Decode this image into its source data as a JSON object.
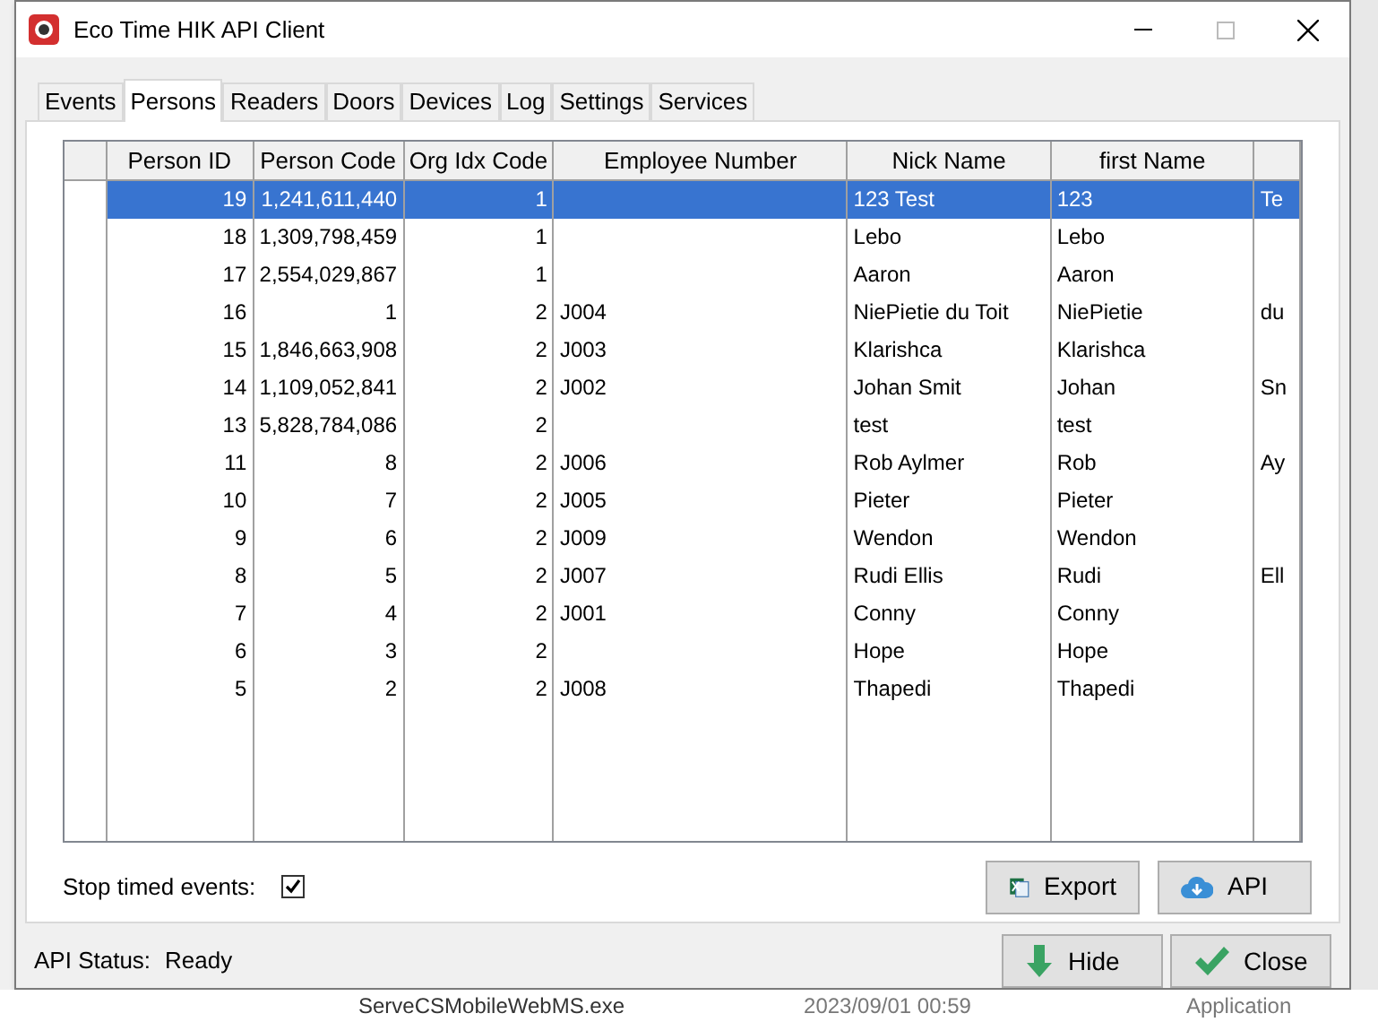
{
  "window": {
    "title": "Eco Time HIK API Client"
  },
  "tabs": [
    {
      "label": "Events",
      "selected": false
    },
    {
      "label": "Persons",
      "selected": true
    },
    {
      "label": "Readers",
      "selected": false
    },
    {
      "label": "Doors",
      "selected": false
    },
    {
      "label": "Devices",
      "selected": false
    },
    {
      "label": "Log",
      "selected": false
    },
    {
      "label": "Settings",
      "selected": false
    },
    {
      "label": "Services",
      "selected": false
    }
  ],
  "table": {
    "columns": [
      "Person ID",
      "Person Code",
      "Org Idx Code",
      "Employee Number",
      "Nick Name",
      "first Name",
      ""
    ],
    "rows": [
      {
        "selected": true,
        "cells": [
          "19",
          "1,241,611,440",
          "1",
          "",
          "123 Test",
          "123",
          "Te"
        ]
      },
      {
        "selected": false,
        "cells": [
          "18",
          "1,309,798,459",
          "1",
          "",
          "Lebo",
          "Lebo",
          ""
        ]
      },
      {
        "selected": false,
        "cells": [
          "17",
          "2,554,029,867",
          "1",
          "",
          "Aaron",
          "Aaron",
          ""
        ]
      },
      {
        "selected": false,
        "cells": [
          "16",
          "1",
          "2",
          "J004",
          "NiePietie du Toit",
          "NiePietie",
          "du"
        ]
      },
      {
        "selected": false,
        "cells": [
          "15",
          "1,846,663,908",
          "2",
          "J003",
          "Klarishca",
          "Klarishca",
          ""
        ]
      },
      {
        "selected": false,
        "cells": [
          "14",
          "1,109,052,841",
          "2",
          "J002",
          "Johan Smit",
          "Johan",
          "Sn"
        ]
      },
      {
        "selected": false,
        "cells": [
          "13",
          "5,828,784,086",
          "2",
          "",
          "test",
          "test",
          ""
        ]
      },
      {
        "selected": false,
        "cells": [
          "11",
          "8",
          "2",
          "J006",
          "Rob Aylmer",
          "Rob",
          "Ay"
        ]
      },
      {
        "selected": false,
        "cells": [
          "10",
          "7",
          "2",
          "J005",
          "Pieter",
          "Pieter",
          ""
        ]
      },
      {
        "selected": false,
        "cells": [
          "9",
          "6",
          "2",
          "J009",
          "Wendon",
          "Wendon",
          ""
        ]
      },
      {
        "selected": false,
        "cells": [
          "8",
          "5",
          "2",
          "J007",
          "Rudi Ellis",
          "Rudi",
          "Ell"
        ]
      },
      {
        "selected": false,
        "cells": [
          "7",
          "4",
          "2",
          "J001",
          "Conny",
          "Conny",
          ""
        ]
      },
      {
        "selected": false,
        "cells": [
          "6",
          "3",
          "2",
          "",
          "Hope",
          "Hope",
          ""
        ]
      },
      {
        "selected": false,
        "cells": [
          "5",
          "2",
          "2",
          "J008",
          "Thapedi",
          "Thapedi",
          ""
        ]
      }
    ]
  },
  "stop_timed_events": {
    "label": "Stop timed events:",
    "checked": true
  },
  "buttons": [
    {
      "kind": "export",
      "label": "Export"
    },
    {
      "kind": "api",
      "label": "API"
    }
  ],
  "status": {
    "label": "API Status:",
    "value": "Ready"
  },
  "footer_buttons": [
    {
      "kind": "hide",
      "label": "Hide"
    },
    {
      "kind": "close",
      "label": "Close"
    }
  ],
  "background_row": {
    "name": "ServeCSMobileWebMS.exe",
    "date": "2023/09/01 00:59",
    "type": "Application"
  }
}
